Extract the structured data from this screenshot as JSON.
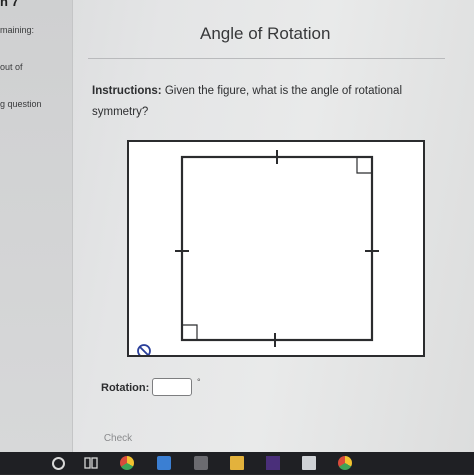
{
  "sidebar": {
    "question_fragment": "n 7",
    "remaining_fragment": "maining:",
    "score_fragment": "out of",
    "skip_fragment": "g question"
  },
  "main": {
    "title": "Angle of Rotation",
    "instructions_label": "Instructions:",
    "instructions_text": " Given the figure, what is the angle of rotational symmetry?",
    "rotation_label": "Rotation:",
    "rotation_value": "",
    "degree_symbol": "°",
    "check_label": "Check"
  },
  "figure": {
    "shape": "square",
    "marks": [
      "equal-side tick marks on all four sides",
      "right-angle markers at two corners",
      "no-symbol icon at bottom-left"
    ]
  },
  "taskbar": {
    "icons": [
      "start-circle-icon",
      "task-view-icon",
      "chrome-icon",
      "edge-icon",
      "store-icon",
      "file-explorer-icon",
      "app-icon",
      "mail-icon",
      "chrome-icon"
    ]
  },
  "colors": {
    "figure_stroke": "#2b2c2e",
    "no_symbol": "#2a3f9a"
  }
}
